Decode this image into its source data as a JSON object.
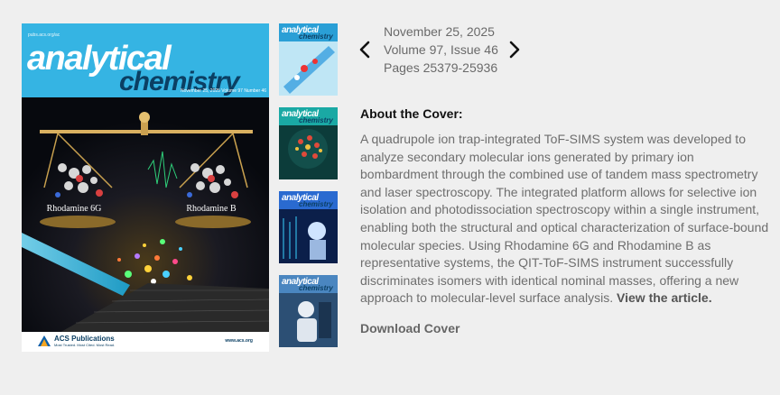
{
  "cover": {
    "url_text": "pubs.acs.org/ac",
    "title_line1": "analytical",
    "title_line2": "chemistry",
    "issue_text": "November 25, 2025 Volume 97 Number 46",
    "label_left": "Rhodamine 6G",
    "label_right": "Rhodamine B",
    "publisher": "ACS Publications",
    "publisher_tagline": "Most Trusted. Most Cited. Most Read.",
    "site": "www.acs.org"
  },
  "thumbnails": [
    {
      "title1": "analytical",
      "title2": "chemistry",
      "color": "#2a9fd6"
    },
    {
      "title1": "analytical",
      "title2": "chemistry",
      "color": "#0f8a87"
    },
    {
      "title1": "analytical",
      "title2": "chemistry",
      "color": "#1d3f8a"
    },
    {
      "title1": "analytical",
      "title2": "chemistry",
      "color": "#3a6ea5"
    }
  ],
  "issue": {
    "date": "November 25, 2025",
    "volume": "Volume 97, Issue 46",
    "pages": "Pages 25379-25936"
  },
  "about": {
    "heading": "About the Cover:",
    "body": "A quadrupole ion trap-integrated ToF-SIMS system was developed to analyze secondary molecular ions generated by primary ion bombardment through the combined use of tandem mass spectrometry and laser spectroscopy. The integrated platform allows for selective ion isolation and photodissociation spectroscopy within a single instrument, enabling both the structural and optical characterization of surface-bound molecular species. Using Rhodamine 6G and Rhodamine B as representative systems, the QIT-ToF-SIMS instrument successfully discriminates isomers with identical nominal masses, offering a new approach to molecular-level surface analysis.",
    "link_text": "View the article."
  },
  "download_label": "Download Cover"
}
